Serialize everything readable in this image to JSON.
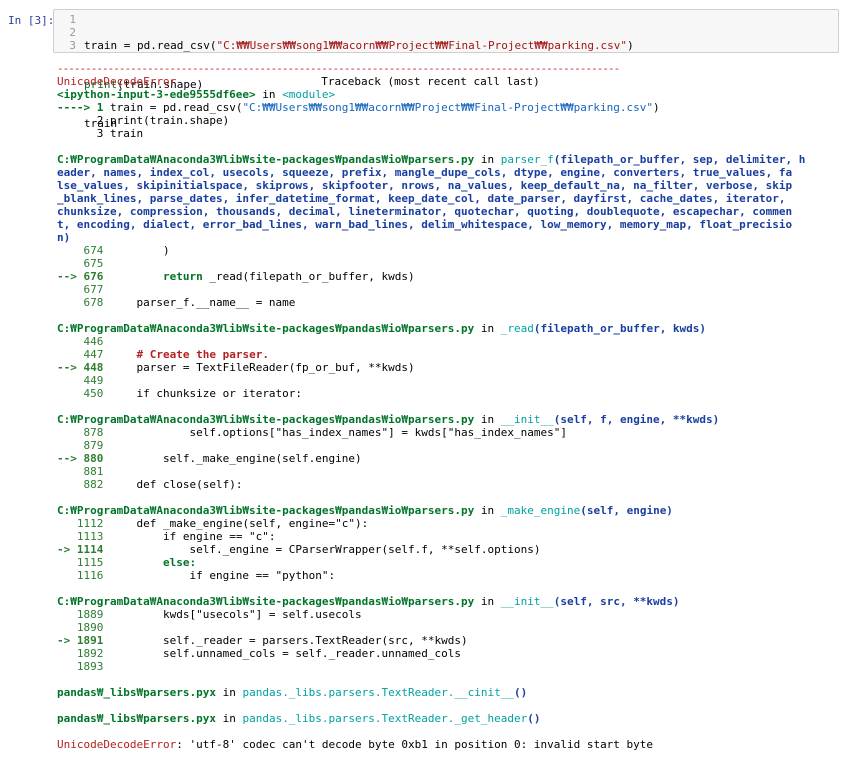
{
  "prompt": "In [3]:",
  "code_lines": [
    {
      "num": "1",
      "a": "train = pd.read_csv(",
      "s": "\"C:₩₩Users₩₩song1₩₩acorn₩₩Project₩₩Final-Project₩₩parking.csv\"",
      "b": ")"
    },
    {
      "num": "2",
      "a": "print",
      "s": "",
      "b": "(train.shape)"
    },
    {
      "num": "3",
      "a": "train",
      "s": "",
      "b": ""
    }
  ],
  "error": {
    "name": "UnicodeDecodeError",
    "traceback_label": "Traceback (most recent call last)",
    "input_ref": "<ipython-input-3-ede9555df6ee>",
    "in_word": " in ",
    "module": "<module>",
    "arrow1": "----> 1 ",
    "arrow1_code": "train = pd.read_csv(",
    "arrow1_str": "\"C:₩₩Users₩₩song1₩₩acorn₩₩Project₩₩Final-Project₩₩parking.csv\"",
    "arrow1_end": ")",
    "l2": "      2 print(train.shape)",
    "l3": "      3 train",
    "file_parsers": "C:₩ProgramData₩Anaconda3₩lib₩site-packages₩pandas₩io₩parsers.py",
    "parser_f": "parser_f",
    "parser_f_args": [
      "(filepath_or_buffer, sep, delimiter, h",
      "eader, names, index_col, usecols, squeeze, prefix, mangle_dupe_cols, dtype, engine, converters, true_values, fa",
      "lse_values, skipinitialspace, skiprows, skipfooter, nrows, na_values, keep_default_na, na_filter, verbose, skip",
      "_blank_lines, parse_dates, infer_datetime_format, keep_date_col, date_parser, dayfirst, cache_dates, iterator,",
      "chunksize, compression, thousands, decimal, lineterminator, quotechar, quoting, doublequote, escapechar, commen",
      "t, encoding, dialect, error_bad_lines, warn_bad_lines, delim_whitespace, low_memory, memory_map, float_precisio",
      "n)"
    ],
    "f1": [
      {
        "pre": "    674         ",
        "code": ")"
      },
      {
        "pre": "    675",
        "code": ""
      },
      {
        "pre": "--> 676         ",
        "code": "return _read(filepath_or_buffer, kwds)"
      },
      {
        "pre": "    677",
        "code": ""
      },
      {
        "pre": "    678     ",
        "code": "parser_f.__name__ = name"
      }
    ],
    "read_fn": "_read",
    "read_args": "(filepath_or_buffer, kwds)",
    "f2": [
      {
        "pre": "    446",
        "code": ""
      },
      {
        "pre": "    447     ",
        "code": "# Create the parser."
      },
      {
        "pre": "--> 448     ",
        "code": "parser = TextFileReader(fp_or_buf, **kwds)"
      },
      {
        "pre": "    449",
        "code": ""
      },
      {
        "pre": "    450     ",
        "code": "if chunksize or iterator:"
      }
    ],
    "init_fn": "__init__",
    "init_args1": "(self, f, engine, **kwds)",
    "f3": [
      {
        "pre": "    878             ",
        "code": "self.options[\"has_index_names\"] = kwds[\"has_index_names\"]"
      },
      {
        "pre": "    879",
        "code": ""
      },
      {
        "pre": "--> 880         ",
        "code": "self._make_engine(self.engine)"
      },
      {
        "pre": "    881",
        "code": ""
      },
      {
        "pre": "    882     ",
        "code": "def close(self):"
      }
    ],
    "make_fn": "_make_engine",
    "make_args": "(self, engine)",
    "f4": [
      {
        "pre": "   1112     ",
        "code": "def _make_engine(self, engine=\"c\"):"
      },
      {
        "pre": "   1113         ",
        "code": "if engine == \"c\":"
      },
      {
        "pre": "-> 1114             ",
        "code": "self._engine = CParserWrapper(self.f, **self.options)"
      },
      {
        "pre": "   1115         ",
        "code": "else:"
      },
      {
        "pre": "   1116             ",
        "code": "if engine == \"python\":"
      }
    ],
    "init_args2": "(self, src, **kwds)",
    "f5": [
      {
        "pre": "   1889         ",
        "code": "kwds[\"usecols\"] = self.usecols"
      },
      {
        "pre": "   1890",
        "code": ""
      },
      {
        "pre": "-> 1891         ",
        "code": "self._reader = parsers.TextReader(src, **kwds)"
      },
      {
        "pre": "   1892         ",
        "code": "self.unnamed_cols = self._reader.unnamed_cols"
      },
      {
        "pre": "   1893",
        "code": ""
      }
    ],
    "pyx_file": "pandas₩_libs₩parsers.pyx",
    "pyx1_fn": "pandas._libs.parsers.TextReader.__cinit__",
    "pyx2_fn": "pandas._libs.parsers.TextReader._get_header",
    "paren": "()",
    "final_msg": ": 'utf-8' codec can't decode byte 0xb1 in position 0: invalid start byte"
  },
  "dash_line": "----------------------------------------------------------------------------------------------------"
}
